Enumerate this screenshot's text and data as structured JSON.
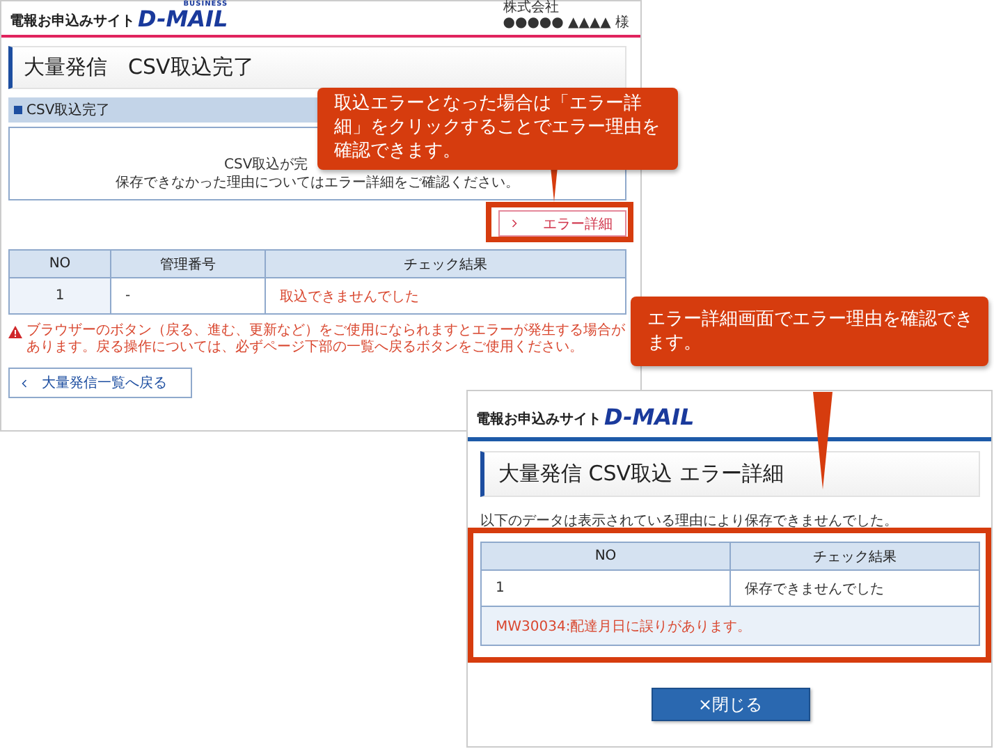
{
  "main_screen": {
    "site_label": "電報お申込みサイト",
    "logo": "D-MAIL",
    "logo_tag": "BUSINESS",
    "account": {
      "company": "株式会社",
      "name": "●●●●● ▲▲▲▲ 様"
    },
    "page_title": "大量発信　CSV取込完了",
    "section_title": "CSV取込完了",
    "messages": [
      "CSV取込が完",
      "保存できなかった理由についてはエラー詳細をご確認ください。"
    ],
    "error_detail_button": "エラー詳細",
    "table": {
      "columns": [
        "NO",
        "管理番号",
        "チェック結果"
      ],
      "rows": [
        [
          "1",
          "-",
          "取込できませんでした"
        ]
      ]
    },
    "warning": "ブラウザーのボタン（戻る、進む、更新など）をご使用になられますとエラーが発生する場合があります。戻る操作については、必ずページ下部の一覧へ戻るボタンをご使用ください。",
    "back_button": "大量発信一覧へ戻る"
  },
  "detail_screen": {
    "site_label": "電報お申込みサイト",
    "logo": "D-MAIL",
    "page_title": "大量発信 CSV取込 エラー詳細",
    "description": "以下のデータは表示されている理由により保存できませんでした。",
    "table": {
      "columns": [
        "NO",
        "チェック結果"
      ],
      "rows": [
        [
          "1",
          "保存できませんでした"
        ]
      ],
      "error_message": "MW30034:配達月日に誤りがあります。"
    },
    "close_button": "×閉じる"
  },
  "callouts": [
    {
      "text": "取込エラーとなった場合は「エラー詳細」をクリックすることでエラー理由を確認できます。"
    },
    {
      "text": "エラー詳細画面でエラー理由を確認できます。"
    }
  ]
}
